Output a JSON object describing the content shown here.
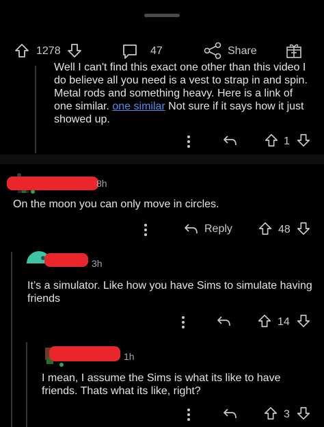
{
  "post_actions": {
    "upvotes": "1278",
    "comments": "47",
    "share_label": "Share"
  },
  "comment1": {
    "text_before_link": "Well I can't find this exact one other than this video I do believe all you need is a vest to strap in and spin. Metal rods and something heavy. Here is a link of one similar. ",
    "link_text": "one similar",
    "text_after_link": " Not sure if it says how it just showed up.",
    "votes": "1"
  },
  "comment2": {
    "timestamp": "8h",
    "text": "On the moon you can only move in circles.",
    "reply_label": "Reply",
    "votes": "48"
  },
  "comment3": {
    "timestamp": "3h",
    "text": "It’s a simulator. Like how you have Sims to simulate having friends",
    "votes": "14"
  },
  "comment4": {
    "timestamp": "1h",
    "text": "I mean, I assume the Sims is what its like to have friends. Thats what its like, right?",
    "votes": "3"
  },
  "colors": {
    "link": "#4f8fe6",
    "redaction": "#e8262c",
    "background": "#000000"
  }
}
